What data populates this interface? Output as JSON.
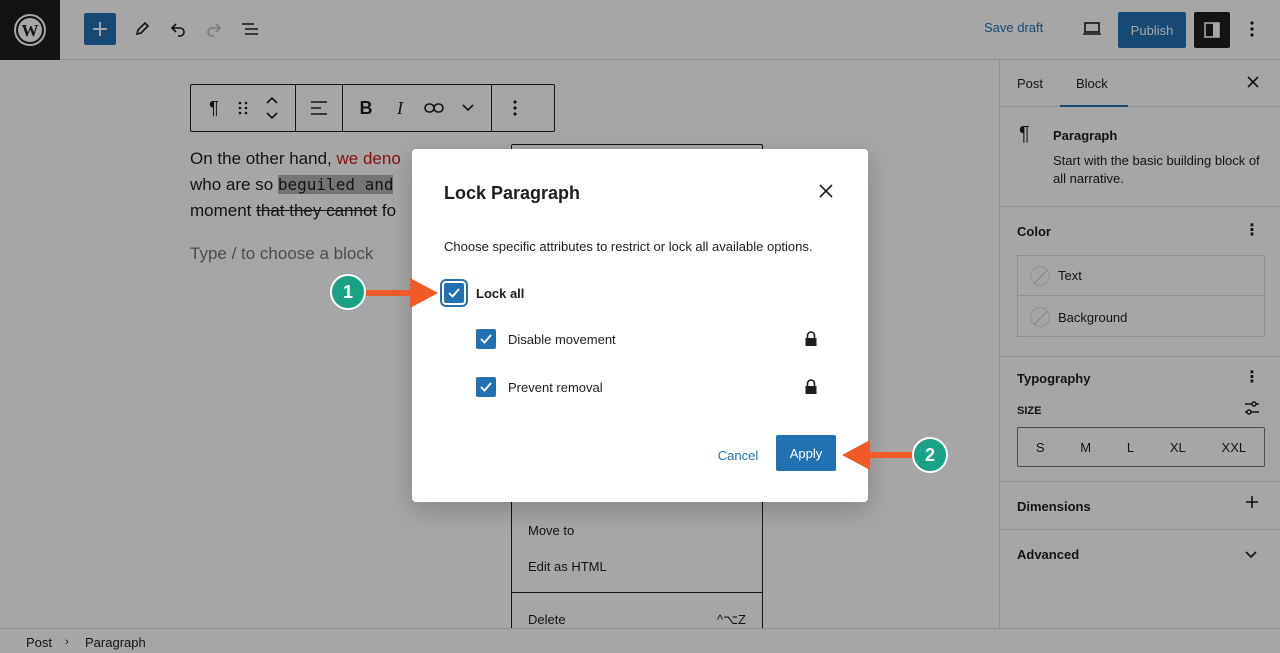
{
  "topbar": {
    "save_draft": "Save draft",
    "publish": "Publish"
  },
  "editor": {
    "para_part1": "On the other hand, ",
    "para_red": "we deno",
    "para_part2": "who are so ",
    "para_code": "beguiled and",
    "para_part3": "moment ",
    "para_strike": "that they cannot",
    "para_part4": " fo",
    "placeholder": "Type / to choose a block"
  },
  "options_menu": {
    "items": [
      "Move to",
      "Edit as HTML",
      "Delete"
    ],
    "delete_shortcut": "^⌥Z"
  },
  "sidebar": {
    "tabs": [
      "Post",
      "Block"
    ],
    "active_tab": "Block",
    "block_title": "Paragraph",
    "block_desc": "Start with the basic building block of all narrative.",
    "color_title": "Color",
    "color_items": [
      "Text",
      "Background"
    ],
    "typography_title": "Typography",
    "size_label": "SIZE",
    "sizes": [
      "S",
      "M",
      "L",
      "XL",
      "XXL"
    ],
    "dimensions_title": "Dimensions",
    "advanced_title": "Advanced"
  },
  "statusbar": {
    "crumbs": [
      "Post",
      "Paragraph"
    ]
  },
  "dialog": {
    "title": "Lock Paragraph",
    "description": "Choose specific attributes to restrict or lock all available options.",
    "lock_all": "Lock all",
    "disable_movement": "Disable movement",
    "prevent_removal": "Prevent removal",
    "cancel": "Cancel",
    "apply": "Apply"
  },
  "annotations": {
    "step1": "1",
    "step2": "2",
    "arrow_color": "#f05a28",
    "badge_color": "#1aa286"
  },
  "colors": {
    "accent": "#2271b1",
    "dark": "#1e1e1e"
  }
}
